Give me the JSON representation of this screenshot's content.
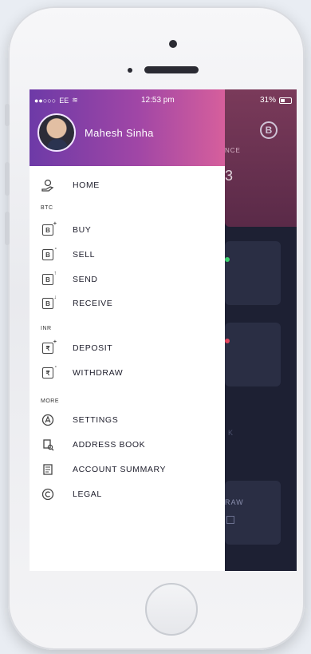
{
  "status_bar": {
    "carrier": "EE",
    "time": "12:53 pm",
    "battery": "31%"
  },
  "profile": {
    "name": "Mahesh Sinha"
  },
  "menu": {
    "home": "HOME",
    "sections": {
      "btc": {
        "title": "BTC",
        "items": [
          "BUY",
          "SELL",
          "SEND",
          "RECEIVE"
        ]
      },
      "inr": {
        "title": "INR",
        "items": [
          "DEPOSIT",
          "WITHDRAW"
        ]
      },
      "more": {
        "title": "MORE",
        "items": [
          "SETTINGS",
          "ADDRESS BOOK",
          "ACCOUNT SUMMARY",
          "LEGAL"
        ]
      }
    }
  },
  "background_app": {
    "balance_label": "NCE",
    "balance_value": "3",
    "coin_symbol": "B",
    "faded_label": "K",
    "withdraw_label": "RAW"
  },
  "colors": {
    "drawer_gradient_start": "#6d3aa7",
    "drawer_gradient_end": "#d65f9c",
    "app_background": "#1d2033"
  },
  "icons": {
    "home": "hand-coin-icon",
    "buy": "coin-plus-icon",
    "sell": "coin-minus-icon",
    "send": "coin-send-icon",
    "receive": "coin-receive-icon",
    "deposit": "rupee-plus-icon",
    "withdraw": "rupee-minus-icon",
    "settings": "settings-icon",
    "address_book": "address-book-icon",
    "account_summary": "account-summary-icon",
    "legal": "copyright-icon"
  }
}
